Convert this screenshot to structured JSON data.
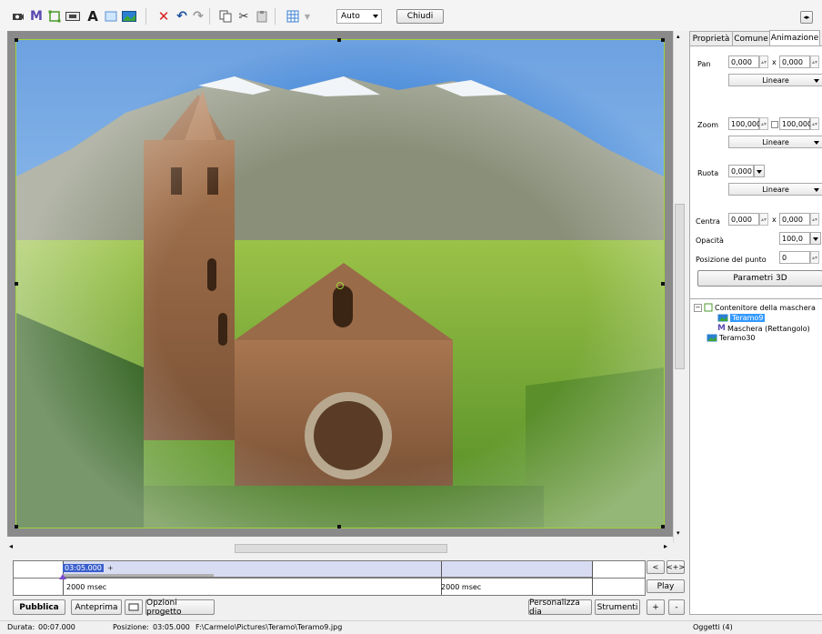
{
  "toolbar": {
    "mode_select": "Auto",
    "close_label": "Chiudi"
  },
  "timeline": {
    "time_marker": "03:05.000",
    "time_marker_suffix": "+",
    "duration_left": "2000 msec",
    "duration_right": "2000 msec",
    "nav_left": "<",
    "nav_right": "<+>",
    "play_label": "Play",
    "plus_label": "+",
    "minus_label": "-"
  },
  "bottom_bar": {
    "publish": "Pubblica",
    "preview": "Anteprima",
    "project_options": "Opzioni progetto",
    "customize_slide": "Personalizza dia",
    "tools": "Strumenti"
  },
  "panel": {
    "tabs": [
      "Proprietà",
      "Comune",
      "Animazione"
    ],
    "active_tab": "Animazione",
    "pan": {
      "label": "Pan",
      "x": "0,000",
      "sep": "x",
      "y": "0,000",
      "interp": "Lineare"
    },
    "zoom": {
      "label": "Zoom",
      "x": "100,000",
      "y": "100,000",
      "interp": "Lineare"
    },
    "rotate": {
      "label": "Ruota",
      "value": "0,000",
      "interp": "Lineare"
    },
    "center": {
      "label": "Centra",
      "x": "0,000",
      "sep": "x",
      "y": "0,000"
    },
    "opacity": {
      "label": "Opacità",
      "value": "100,0"
    },
    "point_position": {
      "label": "Posizione del punto",
      "value": "0"
    },
    "params3d": "Parametri 3D"
  },
  "tree": {
    "items": [
      {
        "label": "Contenitore della maschera",
        "icon": "mask-container-icon"
      },
      {
        "label": "Teramo9",
        "icon": "image-icon",
        "selected": true
      },
      {
        "label": "Maschera (Rettangolo)",
        "icon": "mask-icon"
      },
      {
        "label": "Teramo30",
        "icon": "image-icon"
      }
    ]
  },
  "status": {
    "duration_label": "Durata:",
    "duration_value": "00:07.000",
    "position_label": "Posizione:",
    "position_value": "03:05.000",
    "path": "F:\\Carmelo\\Pictures\\Teramo\\Teramo9.jpg",
    "objects": "Oggetti (4)"
  },
  "colors": {
    "selection": "#3399ff",
    "timeline_bar": "#d8dcf2",
    "frame_border": "#9fd23a"
  }
}
